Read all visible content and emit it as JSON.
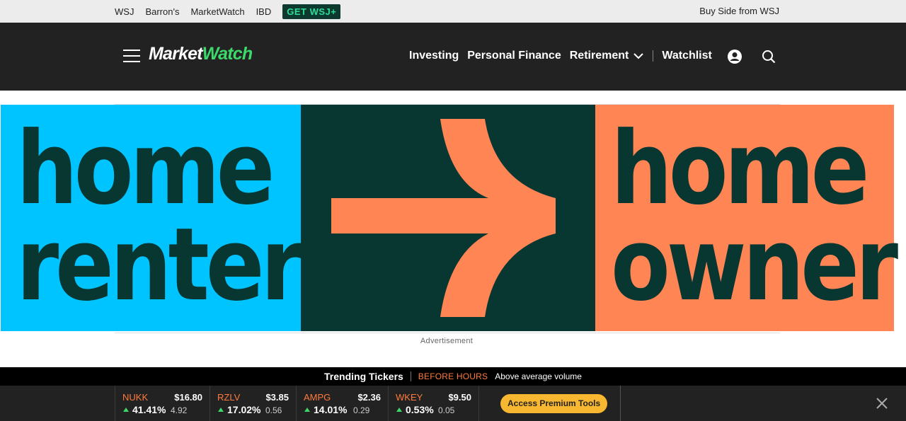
{
  "topbar": {
    "links": [
      "WSJ",
      "Barron's",
      "MarketWatch",
      "IBD"
    ],
    "get_wsj": "GET WSJ+",
    "buy_side": "Buy Side from WSJ"
  },
  "header": {
    "logo_a": "Market",
    "logo_b": "Watch",
    "nav": [
      "Investing",
      "Personal Finance",
      "Retirement"
    ],
    "watchlist": "Watchlist"
  },
  "ad": {
    "left_line1": "home",
    "left_line2": "renter",
    "right_line1": "home",
    "right_line2": "owner",
    "label": "Advertisement",
    "colors": {
      "left": "#00c4ff",
      "middle": "#083630",
      "right": "#ff8555"
    }
  },
  "trending": {
    "title": "Trending Tickers",
    "when": "BEFORE HOURS",
    "desc": "Above average volume"
  },
  "tickers": [
    {
      "symbol": "NUKK",
      "price": "$16.80",
      "pct": "41.41%",
      "change": "4.92"
    },
    {
      "symbol": "RZLV",
      "price": "$3.85",
      "pct": "17.02%",
      "change": "0.56"
    },
    {
      "symbol": "AMPG",
      "price": "$2.36",
      "pct": "14.01%",
      "change": "0.29"
    },
    {
      "symbol": "WKEY",
      "price": "$9.50",
      "pct": "0.53%",
      "change": "0.05"
    }
  ],
  "premium_button": "Access Premium Tools",
  "colors": {
    "accent_green": "#3cd96a",
    "accent_orange": "#ff7a3d",
    "premium_yellow": "#f7b731"
  }
}
